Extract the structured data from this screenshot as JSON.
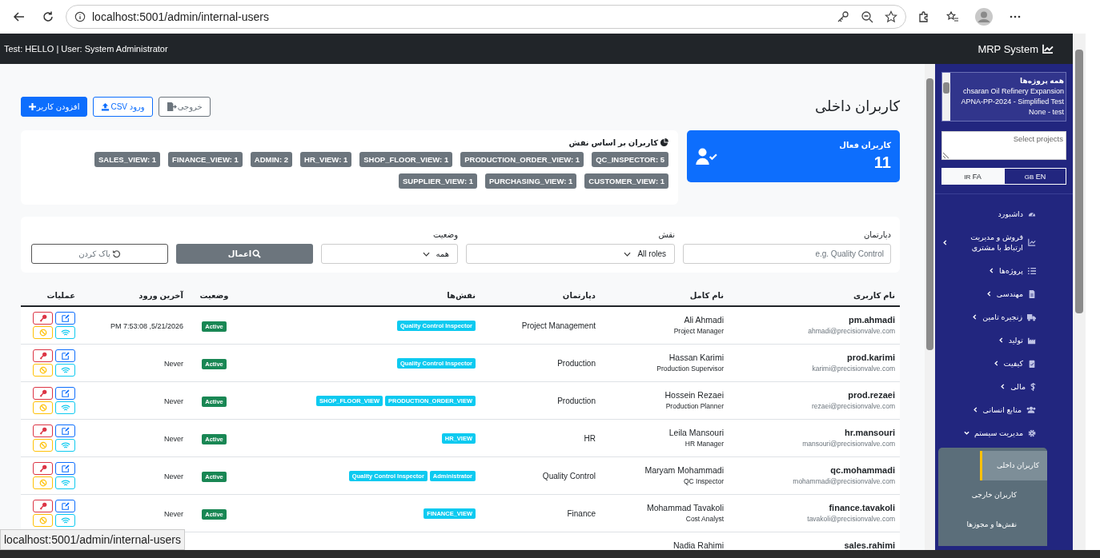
{
  "browser": {
    "url": "localhost:5001/admin/internal-users"
  },
  "topbar": {
    "info": "Test: HELLO | User: System Administrator",
    "brand": "MRP System"
  },
  "page": {
    "title": "کاربران داخلی",
    "buttons": [
      {
        "label": "خروجی",
        "kind": "secondary"
      },
      {
        "label": "ورود CSV",
        "kind": "outline"
      },
      {
        "label": "افزودن کاربر",
        "kind": "primary"
      }
    ]
  },
  "stat_card": {
    "label": "کاربران فعال",
    "value": "11"
  },
  "roles_card": {
    "title": "کاربران بر اساس نقش",
    "badges": [
      "QC_INSPECTOR: 5",
      "PRODUCTION_ORDER_VIEW: 1",
      "SHOP_FLOOR_VIEW: 1",
      "HR_VIEW: 1",
      "ADMIN: 2",
      "FINANCE_VIEW: 1",
      "SALES_VIEW: 1",
      "CUSTOMER_VIEW: 1",
      "PURCHASING_VIEW: 1",
      "SUPPLIER_VIEW: 1"
    ]
  },
  "filters": {
    "department": {
      "label": "دپارتمان",
      "placeholder": "e.g. Quality Control"
    },
    "role": {
      "label": "نقش",
      "value": "All roles"
    },
    "status": {
      "label": "وضعیت",
      "value": "همه"
    },
    "apply": "اعمال",
    "clear": "پاک کردن"
  },
  "table": {
    "columns": [
      "نام کاربری",
      "نام کامل",
      "دپارتمان",
      "نقش‌ها",
      "وضعیت",
      "آخرین ورود",
      "عملیات"
    ],
    "rows": [
      {
        "username": "pm.ahmadi",
        "email": "ahmadi@precisionvalve.com",
        "full_name": "Ali Ahmadi",
        "job_title": "Project Manager",
        "department": "Project Management",
        "roles": [
          "Quality Control Inspector"
        ],
        "status": "Active",
        "last_login": "5/21/2026, 7:53:08 PM"
      },
      {
        "username": "prod.karimi",
        "email": "karimi@precisionvalve.com",
        "full_name": "Hassan Karimi",
        "job_title": "Production Supervisor",
        "department": "Production",
        "roles": [
          "Quality Control Inspector"
        ],
        "status": "Active",
        "last_login": "Never"
      },
      {
        "username": "prod.rezaei",
        "email": "rezaei@precisionvalve.com",
        "full_name": "Hossein Rezaei",
        "job_title": "Production Planner",
        "department": "Production",
        "roles": [
          "PRODUCTION_ORDER_VIEW",
          "SHOP_FLOOR_VIEW"
        ],
        "status": "Active",
        "last_login": "Never"
      },
      {
        "username": "hr.mansouri",
        "email": "mansouri@precisionvalve.com",
        "full_name": "Leila Mansouri",
        "job_title": "HR Manager",
        "department": "HR",
        "roles": [
          "HR_VIEW"
        ],
        "status": "Active",
        "last_login": "Never"
      },
      {
        "username": "qc.mohammadi",
        "email": "mohammadi@precisionvalve.com",
        "full_name": "Maryam Mohammadi",
        "job_title": "QC Inspector",
        "department": "Quality Control",
        "roles": [
          "Administrator",
          "Quality Control Inspector"
        ],
        "status": "Active",
        "last_login": "Never"
      },
      {
        "username": "finance.tavakoli",
        "email": "tavakoli@precisionvalve.com",
        "full_name": "Mohammad Tavakoli",
        "job_title": "Cost Analyst",
        "department": "Finance",
        "roles": [
          "FINANCE_VIEW"
        ],
        "status": "Active",
        "last_login": "Never"
      },
      {
        "username": "sales.rahimi",
        "full_name": "Nadia Rahimi"
      }
    ]
  },
  "sidebar": {
    "projects": [
      "همه پروژه‌ها",
      "chsaran Oil Refinery Expansion",
      "APNA-PP-2024 - Simplified Test",
      "None - test"
    ],
    "project_search": {
      "placeholder": "Select projects"
    },
    "languages": [
      {
        "flag": "GB",
        "label": "EN",
        "selected": false
      },
      {
        "flag": "IR",
        "label": "FA",
        "selected": true
      }
    ],
    "items": [
      {
        "label": "داشبورد",
        "kind": "link"
      },
      {
        "label": "فروش و مدیریت ارتباط با مشتری",
        "kind": "group",
        "expanded": false
      },
      {
        "label": "پروژه‌ها",
        "kind": "group",
        "expanded": false
      },
      {
        "label": "مهندسی",
        "kind": "group",
        "expanded": false
      },
      {
        "label": "زنجیره تامین",
        "kind": "group",
        "expanded": false
      },
      {
        "label": "تولید",
        "kind": "group",
        "expanded": false
      },
      {
        "label": "کیفیت",
        "kind": "group",
        "expanded": false
      },
      {
        "label": "مالی",
        "kind": "group",
        "expanded": false
      },
      {
        "label": "منابع انسانی",
        "kind": "group",
        "expanded": false
      },
      {
        "label": "مدیریت سیستم",
        "kind": "group",
        "expanded": true,
        "children": [
          {
            "label": "کاربران داخلی",
            "selected": true
          },
          {
            "label": "کاربران خارجی",
            "selected": false
          },
          {
            "label": "نقش‌ها و مجوزها",
            "selected": false
          }
        ]
      }
    ]
  },
  "status_tooltip": "localhost:5001/admin/internal-users"
}
